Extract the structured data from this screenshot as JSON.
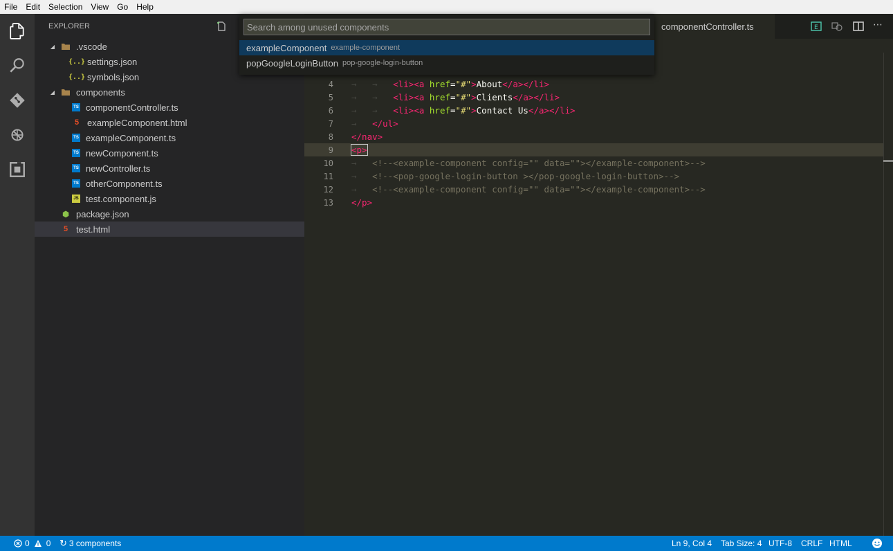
{
  "menu": [
    "File",
    "Edit",
    "Selection",
    "View",
    "Go",
    "Help"
  ],
  "activity_icons": [
    "files-icon",
    "search-icon",
    "git-icon",
    "debug-icon",
    "extensions-icon"
  ],
  "sidebar": {
    "title": "EXPLORER",
    "tree": [
      {
        "label": ".vscode",
        "type": "folder",
        "depth": 1,
        "expanded": true
      },
      {
        "label": "settings.json",
        "type": "json",
        "depth": 2
      },
      {
        "label": "symbols.json",
        "type": "json",
        "depth": 2
      },
      {
        "label": "components",
        "type": "folder",
        "depth": 1,
        "expanded": true
      },
      {
        "label": "componentController.ts",
        "type": "ts",
        "depth": 2
      },
      {
        "label": "exampleComponent.html",
        "type": "html",
        "depth": 2
      },
      {
        "label": "exampleComponent.ts",
        "type": "ts",
        "depth": 2
      },
      {
        "label": "newComponent.ts",
        "type": "ts",
        "depth": 2
      },
      {
        "label": "newController.ts",
        "type": "ts",
        "depth": 2
      },
      {
        "label": "otherComponent.ts",
        "type": "ts",
        "depth": 2
      },
      {
        "label": "test.component.js",
        "type": "js",
        "depth": 2
      },
      {
        "label": "package.json",
        "type": "npm",
        "depth": 1
      },
      {
        "label": "test.html",
        "type": "html",
        "depth": 1,
        "selected": true
      }
    ]
  },
  "editor": {
    "active_tab": "componentController.ts",
    "current_line": 9,
    "lines": [
      {
        "n": "4",
        "indent": 2,
        "parts": [
          [
            "tag",
            "<li"
          ],
          [
            "tag",
            ">"
          ],
          [
            "tag",
            "<a "
          ],
          [
            "attr",
            "href"
          ],
          [
            "txt",
            "="
          ],
          [
            "str",
            "\"#\""
          ],
          [
            "tag",
            ">"
          ],
          [
            "txt",
            "About"
          ],
          [
            "tag",
            "</a>"
          ],
          [
            "tag",
            "</li>"
          ]
        ]
      },
      {
        "n": "5",
        "indent": 2,
        "parts": [
          [
            "tag",
            "<li"
          ],
          [
            "tag",
            ">"
          ],
          [
            "tag",
            "<a "
          ],
          [
            "attr",
            "href"
          ],
          [
            "txt",
            "="
          ],
          [
            "str",
            "\"#\""
          ],
          [
            "tag",
            ">"
          ],
          [
            "txt",
            "Clients"
          ],
          [
            "tag",
            "</a>"
          ],
          [
            "tag",
            "</li>"
          ]
        ]
      },
      {
        "n": "6",
        "indent": 2,
        "parts": [
          [
            "tag",
            "<li"
          ],
          [
            "tag",
            ">"
          ],
          [
            "tag",
            "<a "
          ],
          [
            "attr",
            "href"
          ],
          [
            "txt",
            "="
          ],
          [
            "str",
            "\"#\""
          ],
          [
            "tag",
            ">"
          ],
          [
            "txt",
            "Contact Us"
          ],
          [
            "tag",
            "</a>"
          ],
          [
            "tag",
            "</li>"
          ]
        ]
      },
      {
        "n": "7",
        "indent": 1,
        "parts": [
          [
            "tag",
            "</ul>"
          ]
        ]
      },
      {
        "n": "8",
        "indent": 0,
        "parts": [
          [
            "tag",
            "</nav>"
          ]
        ]
      },
      {
        "n": "9",
        "indent": 0,
        "parts": [
          [
            "tag",
            "<p>"
          ]
        ]
      },
      {
        "n": "10",
        "indent": 1,
        "parts": [
          [
            "cm",
            "<!--<example-component config=\"\" data=\"\"></example-component>-->"
          ]
        ]
      },
      {
        "n": "11",
        "indent": 1,
        "parts": [
          [
            "cm",
            "<!--<pop-google-login-button ></pop-google-login-button>-->"
          ]
        ]
      },
      {
        "n": "12",
        "indent": 1,
        "parts": [
          [
            "cm",
            "<!--<example-component config=\"\" data=\"\"></example-component>-->"
          ]
        ]
      },
      {
        "n": "13",
        "indent": 0,
        "parts": [
          [
            "tag",
            "</p>"
          ]
        ]
      }
    ]
  },
  "quickpick": {
    "placeholder": "Search among unused components",
    "items": [
      {
        "label": "exampleComponent",
        "description": "example-component",
        "selected": true
      },
      {
        "label": "popGoogleLoginButton",
        "description": "pop-google-login-button",
        "selected": false
      }
    ]
  },
  "status": {
    "errors": "0",
    "warnings": "0",
    "components": "3 components",
    "position": "Ln 9, Col 4",
    "tab_size": "Tab Size: 4",
    "encoding": "UTF-8",
    "eol": "CRLF",
    "language": "HTML"
  },
  "colors": {
    "statusbar": "#007acc",
    "activitybar": "#333333",
    "sidebar": "#252526",
    "editor": "#272822"
  }
}
